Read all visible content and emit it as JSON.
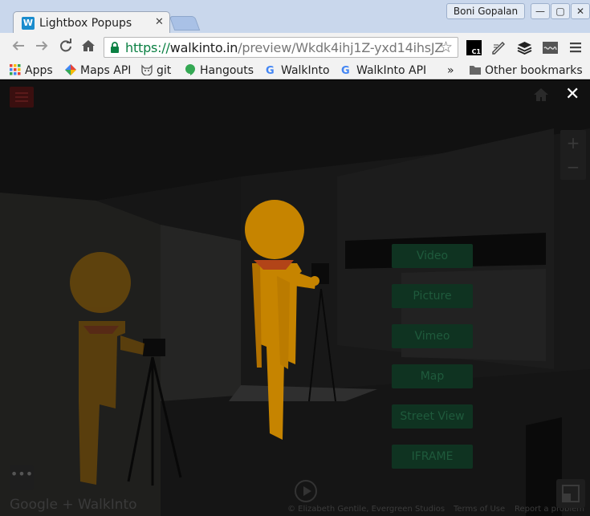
{
  "browser": {
    "tab_title": "Lightbox Popups",
    "tab_favicon_letter": "W",
    "tab_close": "✕",
    "user_name": "Boni Gopalan",
    "window_buttons": [
      "—",
      "▢",
      "✕"
    ],
    "url_scheme": "https://",
    "url_host": "walkinto.in",
    "url_path": "/preview/Wkdk4ihj1Z-yxd14ihsJZ",
    "extension_label": "C1",
    "icons": [
      "back-icon",
      "forward-icon",
      "reload-icon",
      "home-icon",
      "lock-icon",
      "star-icon",
      "menu-icon"
    ]
  },
  "bookmarks": [
    {
      "label": "Apps",
      "icon": "apps-grid-icon"
    },
    {
      "label": "Maps API",
      "icon": "maps-icon"
    },
    {
      "label": "git",
      "icon": "github-cat-icon"
    },
    {
      "label": "Hangouts",
      "icon": "hangouts-icon"
    },
    {
      "label": "WalkInto",
      "icon": "google-icon"
    },
    {
      "label": "WalkInto API",
      "icon": "google-icon"
    }
  ],
  "bookmarks_overflow": "»",
  "other_bookmarks": "Other bookmarks",
  "lightbox": {
    "close_label": "✕",
    "zoom_in": "+",
    "zoom_out": "−",
    "more_label": "•••",
    "menu_buttons": [
      "Video",
      "Picture",
      "Vimeo",
      "Map",
      "Street View",
      "IFRAME"
    ],
    "brand_google": "Google",
    "brand_name": "WalkInto",
    "attribution": "© Elizabeth Gentile, Evergreen Studios",
    "terms": "Terms of Use",
    "report": "Report a problem"
  },
  "colors": {
    "pegman": "#f2a100",
    "pegman_dark": "#d98a00",
    "pegman_collar": "#d9531e",
    "menu_button_bg": "#0f3321",
    "menu_button_text": "#1f5a3c"
  }
}
